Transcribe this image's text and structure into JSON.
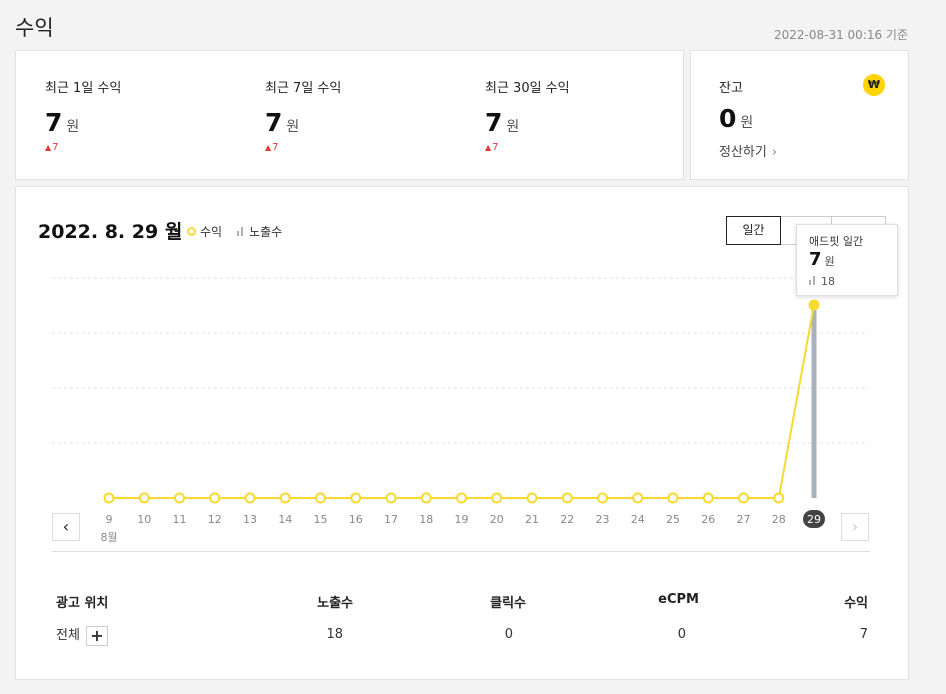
{
  "header": {
    "title": "수익",
    "timestamp": "2022-08-31 00:16 기준"
  },
  "summary": [
    {
      "label": "최근 1일 수익",
      "value": "7",
      "unit": "원",
      "change": "7"
    },
    {
      "label": "최근 7일 수익",
      "value": "7",
      "unit": "원",
      "change": "7"
    },
    {
      "label": "최근 30일 수익",
      "value": "7",
      "unit": "원",
      "change": "7"
    }
  ],
  "balance": {
    "label": "잔고",
    "value": "0",
    "unit": "원",
    "settle_label": "정산하기",
    "badge": "₩"
  },
  "chart_header": {
    "date": "2022. 8. 29 월",
    "legend_revenue": "수익",
    "legend_impressions": "노출수",
    "period_buttons": [
      "일간",
      "",
      ""
    ]
  },
  "tooltip": {
    "title": "애드핏 일간",
    "value": "7",
    "unit": "원",
    "impressions": "18"
  },
  "chart_data": {
    "type": "line",
    "x": [
      "9",
      "10",
      "11",
      "12",
      "13",
      "14",
      "15",
      "16",
      "17",
      "18",
      "19",
      "20",
      "21",
      "22",
      "23",
      "24",
      "25",
      "26",
      "27",
      "28",
      "29"
    ],
    "month_label": "8월",
    "selected": "29",
    "series": [
      {
        "name": "수익",
        "type": "line",
        "color": "#f8d930",
        "values": [
          0,
          0,
          0,
          0,
          0,
          0,
          0,
          0,
          0,
          0,
          0,
          0,
          0,
          0,
          0,
          0,
          0,
          0,
          0,
          0,
          7
        ]
      },
      {
        "name": "노출수",
        "type": "bar",
        "color": "#a8b2bd",
        "values": [
          0,
          0,
          0,
          0,
          0,
          0,
          0,
          0,
          0,
          0,
          0,
          0,
          0,
          0,
          0,
          0,
          0,
          0,
          0,
          0,
          18
        ]
      }
    ],
    "grid": true
  },
  "table": {
    "headers": [
      "광고 위치",
      "노출수",
      "클릭수",
      "eCPM",
      "수익"
    ],
    "row": {
      "position": "전체",
      "impressions": "18",
      "clicks": "0",
      "ecpm": "0",
      "revenue": "7"
    },
    "expand_label": "+"
  },
  "colors": {
    "accent": "#f8d930",
    "bar": "#a8b2bd",
    "up": "#e53935"
  }
}
